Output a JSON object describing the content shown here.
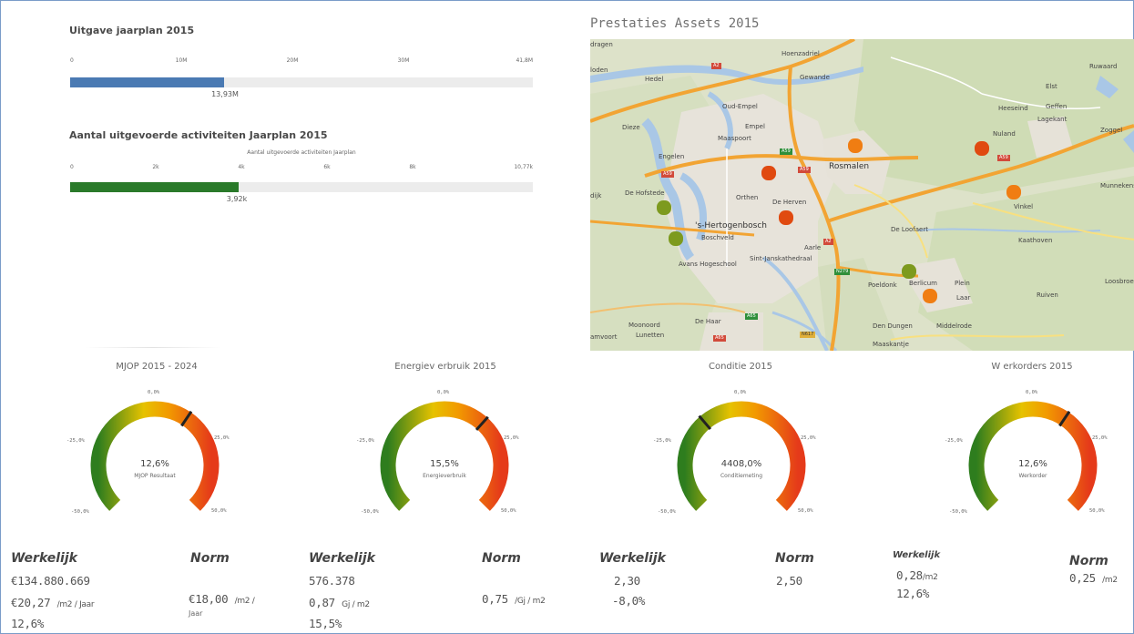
{
  "progress": {
    "spend": {
      "title": "Uitgave jaarplan 2015",
      "ticks": [
        "0",
        "10M",
        "20M",
        "30M",
        "41,8M"
      ],
      "value_label": "13,93M",
      "fraction": 0.3333,
      "color": "#4a7ab3"
    },
    "activities": {
      "title": "Aantal uitgevoerde activiteiten Jaarplan 2015",
      "subtitle": "Aantal uitgevoerde activiteiten Jaarplan",
      "ticks": [
        "0",
        "2k",
        "4k",
        "6k",
        "8k",
        "10,77k"
      ],
      "value_label": "3,92k",
      "fraction": 0.364,
      "color": "#2a7a2a"
    }
  },
  "map": {
    "title": "Prestaties Assets 2015",
    "labels": {
      "hoenzadriel": "Hoenzadriel",
      "gewande": "Gewande",
      "hedel": "Hedel",
      "oud_empel": "Oud-Empel",
      "empel": "Empel",
      "maaspoort": "Maaspoort",
      "engelen": "Engelen",
      "rosmalen": "Rosmalen",
      "orthen": "Orthen",
      "de_herven": "De Herven",
      "hertogenbosch": "'s-Hertogenbosch",
      "boschveld": "Boschveld",
      "avans": "Avans Hogeschool",
      "jeroen": "Sint-Janskathedraal",
      "de_hofstede": "De Hofstede",
      "ruwaard": "Ruwaard",
      "elst": "Elst",
      "geffen": "Geffen",
      "heesbeen": "Heeseind",
      "nuland": "Nuland",
      "zoggel": "Zoggel",
      "vinkel": "Vinkel",
      "munnekens": "Munnekens-Vinkel",
      "de_loofaert": "De Loofaert",
      "kaathoven": "Kaathoven",
      "poeldonk": "Poeldonk",
      "berlicum": "Berlicum",
      "plein": "Plein",
      "laar": "Laar",
      "ruiven": "Ruiven",
      "middelrode": "Middelrode",
      "den_dungen": "Den Dungen",
      "maaskantje": "Maaskantje",
      "de_haar": "De Haar",
      "vlijmen": "Vlijmen",
      "moonoord": "Moonoord",
      "lunetten": "Lunetten",
      "de_gaard": "Lagekant",
      "loosbroek": "Loosbroek",
      "aarle": "Aarle",
      "vught": "Vught",
      "dragen": "dragen",
      "loden": "loden",
      "dijk": "dijk",
      "amvoort": "amvoort",
      "deutekom": "Dieze",
      "a2": "A2",
      "a59": "A59",
      "n279": "N279",
      "a65": "A65",
      "n617": "N617"
    },
    "markers": [
      {
        "color": "#f07d12"
      },
      {
        "color": "#e04a10"
      },
      {
        "color": "#e04a10"
      },
      {
        "color": "#f07d12"
      },
      {
        "color": "#e04a10"
      },
      {
        "color": "#7d9a1e"
      },
      {
        "color": "#7d9a1e"
      },
      {
        "color": "#7d9a1e"
      },
      {
        "color": "#f07d12"
      }
    ]
  },
  "gauges": [
    {
      "title": "MJOP 2015 - 2024",
      "value": "12,6%",
      "label": "MJOP Resultaat",
      "ticks": {
        "top": "0,0%",
        "left": "-25,0%",
        "right": "25,0%",
        "bottom_left": "-50,0%",
        "bottom_right": "50,0%"
      },
      "needle_percent": 12.6,
      "needle_icon": "needle-icon"
    },
    {
      "title": "Energiev erbruik 2015",
      "value": "15,5%",
      "label": "Energieverbruik",
      "ticks": {
        "top": "0,0%",
        "left": "-25,0%",
        "right": "25,0%",
        "bottom_left": "-50,0%",
        "bottom_right": "50,0%"
      },
      "needle_percent": 15.5,
      "needle_icon": "needle-icon"
    },
    {
      "title": "Conditie 2015",
      "value": "4408,0%",
      "label": "Conditiemeting",
      "ticks": {
        "top": "0,0%",
        "left": "-25,0%",
        "right": "25,0%",
        "bottom_left": "-50,0%",
        "bottom_right": "50,0%"
      },
      "needle_percent": -15,
      "needle_icon": "needle-icon"
    },
    {
      "title": "W erkorders 2015",
      "value": "12,6%",
      "label": "Werkorder",
      "ticks": {
        "top": "0,0%",
        "left": "-25,0%",
        "right": "25,0%",
        "bottom_left": "-50,0%",
        "bottom_right": "50,0%"
      },
      "needle_percent": 12.6,
      "needle_icon": "needle-icon"
    }
  ],
  "gauge_colors": {
    "green": "#2e7d1e",
    "yellow": "#e6c200",
    "orange": "#f29a00",
    "red": "#e53a1a"
  },
  "kpis": {
    "mjop": {
      "actual_head": "Werkelijk",
      "actual_line1": "€134.880.669",
      "actual_line2_value": "€20,27",
      "actual_line2_unit": "/m2 / Jaar",
      "actual_line3": "12,6%",
      "norm_head": "Norm",
      "norm_value": "€18,00",
      "norm_unit": "/m2 /",
      "norm_unit2": "Jaar"
    },
    "energy": {
      "actual_head": "Werkelijk",
      "actual_line1": "576.378",
      "actual_line2_value": "0,87",
      "actual_line2_unit": "Gj / m2",
      "actual_line3": "15,5%",
      "norm_head": "Norm",
      "norm_value": "0,75",
      "norm_unit": "/Gj / m2"
    },
    "condition": {
      "actual_head": "Werkelijk",
      "actual_line1": "2,30",
      "actual_line2": "-8,0%",
      "norm_head": "Norm",
      "norm_value": "2,50"
    },
    "workorders": {
      "actual_head": "Werkelijk",
      "actual_line1_value": "0,28",
      "actual_line1_unit": "/m2",
      "actual_line2": "12,6%",
      "norm_head": "Norm",
      "norm_value": "0,25",
      "norm_unit": "/m2"
    }
  }
}
